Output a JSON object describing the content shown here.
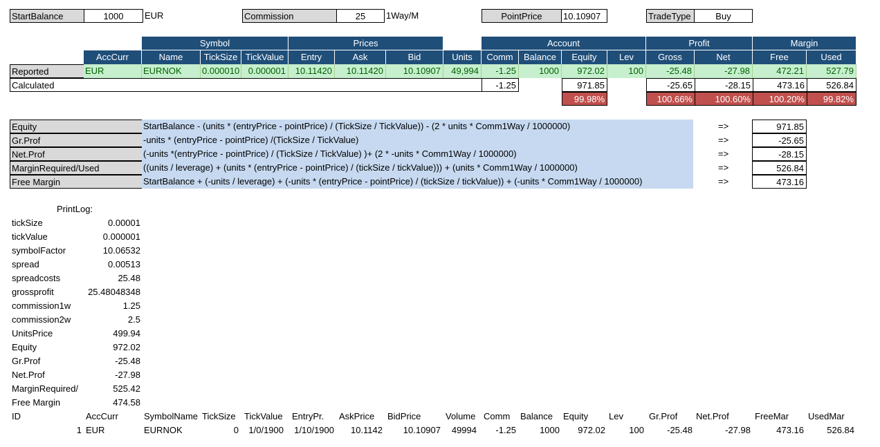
{
  "top": {
    "start_balance_label": "StartBalance",
    "start_balance_value": "1000",
    "start_balance_currency": "EUR",
    "commission_label": "Commission",
    "commission_value": "25",
    "commission_unit": "1Way/M",
    "point_price_label": "PointPrice",
    "point_price_value": "10.10907",
    "trade_type_label": "TradeType",
    "trade_type_value": "Buy"
  },
  "groups": {
    "symbol": "Symbol",
    "prices": "Prices",
    "account": "Account",
    "profit": "Profit",
    "margin": "Margin"
  },
  "columns": [
    "AccCurr",
    "Name",
    "TickSize",
    "TickValue",
    "Entry",
    "Ask",
    "Bid",
    "Units",
    "Comm",
    "Balance",
    "Equity",
    "Lev",
    "Gross",
    "Net",
    "Free",
    "Used"
  ],
  "reported": {
    "label": "Reported",
    "values": [
      "EUR",
      "EURNOK",
      "0.000010",
      "0.000001",
      "10.11420",
      "10.11420",
      "10.10907",
      "49,994",
      "-1.25",
      "1000",
      "972.02",
      "100",
      "-25.48",
      "-27.98",
      "472.21",
      "527.79"
    ]
  },
  "calculated": {
    "label": "Calculated",
    "comm": "-1.25",
    "equity": "971.85",
    "gross": "-25.65",
    "net": "-28.15",
    "free": "473.16",
    "used": "526.84"
  },
  "ratios": {
    "equity": "99.98%",
    "gross": "100.66%",
    "net": "100.60%",
    "free": "100.20%",
    "used": "99.82%"
  },
  "formulas": [
    {
      "label": "Equity",
      "formula": "StartBalance - (units * (entryPrice - pointPrice) / (TickSize / TickValue)) - (2 * units * Comm1Way / 1000000)",
      "arrow": "=>",
      "result": "971.85"
    },
    {
      "label": "Gr.Prof",
      "formula": "-units *  (entryPrice - pointPrice) /(TickSize / TickValue)",
      "arrow": "=>",
      "result": "-25.65"
    },
    {
      "label": "Net.Prof",
      "formula": "(-units *(entryPrice - pointPrice) / (TickSize / TickValue) )+ (2 * -units * Comm1Way / 1000000)",
      "arrow": "=>",
      "result": "-28.15"
    },
    {
      "label": "MarginRequired/Used",
      "formula": "((units / leverage) + (units * (entryPrice - pointPrice) / (tickSize / tickValue))) + (units * Comm1Way / 1000000)",
      "arrow": "=>",
      "result": "526.84"
    },
    {
      "label": "Free Margin",
      "formula": "StartBalance + (-units / leverage) + (-units * (entryPrice - pointPrice) / (tickSize / tickValue)) + (-units * Comm1Way / 1000000)",
      "arrow": "=>",
      "result": "473.16"
    }
  ],
  "printlog": {
    "title": "PrintLog:",
    "rows": [
      {
        "k": "tickSize",
        "v": "0.00001"
      },
      {
        "k": "tickValue",
        "v": "0.000001"
      },
      {
        "k": "symbolFactor",
        "v": "10.06532"
      },
      {
        "k": "spread",
        "v": "0.00513"
      },
      {
        "k": "spreadcosts",
        "v": "25.48"
      },
      {
        "k": "grossprofit",
        "v": "25.48048348"
      },
      {
        "k": "commission1w",
        "v": "1.25"
      },
      {
        "k": "commission2w",
        "v": "2.5"
      },
      {
        "k": "UnitsPrice",
        "v": "499.94"
      },
      {
        "k": "Equity",
        "v": "972.02"
      },
      {
        "k": "Gr.Prof",
        "v": "-25.48"
      },
      {
        "k": "Net.Prof",
        "v": "-27.98"
      },
      {
        "k": "MarginRequired/",
        "v": "525.42"
      },
      {
        "k": "Free Margin",
        "v": "474.58"
      }
    ]
  },
  "bottom": {
    "headers": [
      "ID",
      "AccCurr",
      "SymbolName",
      "TickSize",
      "TickValue",
      "EntryPr.",
      "AskPrice",
      "BidPrice",
      "Volume",
      "Comm",
      "Balance",
      "Equity",
      "Lev",
      "Gr.Prof",
      "Net.Prof",
      "FreeMar",
      "UsedMar"
    ],
    "row": [
      "1",
      "EUR",
      "EURNOK",
      "0",
      "1/0/1900",
      "1/10/1900",
      "10.1142",
      "10.10907",
      "49994",
      "-1.25",
      "1000",
      "972.02",
      "100",
      "-25.48",
      "-27.98",
      "473.16",
      "526.84"
    ]
  }
}
